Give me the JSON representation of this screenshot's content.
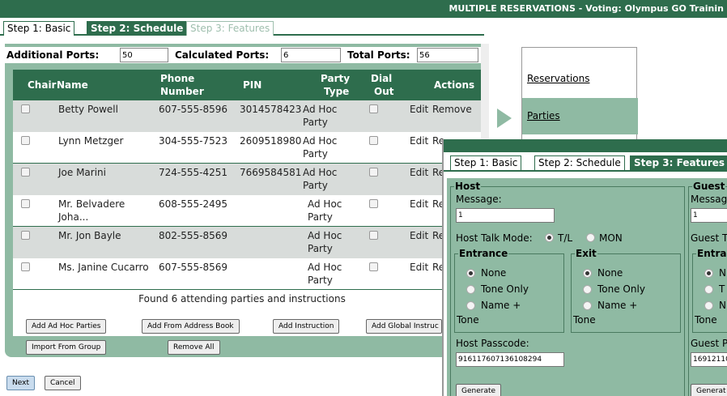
{
  "window_title": "MULTIPLE RESERVATIONS - Voting: Olympus GO Trainin",
  "tabs": [
    "Step 1: Basic",
    "Step 2: Schedule",
    "Step 3: Features"
  ],
  "ports": {
    "additional_label": "Additional Ports:",
    "additional_value": "50",
    "calculated_label": "Calculated Ports:",
    "calculated_value": "6",
    "total_label": "Total Ports:",
    "total_value": "56"
  },
  "columns": {
    "chair": "Chair",
    "name": "Name",
    "phone1": "Phone",
    "phone2": "Number",
    "pin": "PIN",
    "type1": "Party",
    "type2": "Type",
    "dial1": "Dial",
    "dial2": "Out",
    "actions": "Actions"
  },
  "rows": [
    {
      "drag": "::",
      "name1": "Betty Powell",
      "name2": "",
      "phone": "607-555-8596",
      "pin": "3014578423",
      "type1": "Ad Hoc",
      "type2": "Party",
      "edit": "Edit",
      "remove": "Remove"
    },
    {
      "drag": "::",
      "name1": "Lynn Metzger",
      "name2": "",
      "phone": "304-555-7523",
      "pin": "2609518980",
      "type1": "Ad Hoc",
      "type2": "Party",
      "edit": "Edit",
      "remove": "Re"
    },
    {
      "drag": "::",
      "name1": "Joe Marini",
      "name2": "",
      "phone": "724-555-4251",
      "pin": "7669584581",
      "type1": "Ad Hoc",
      "type2": "Party",
      "edit": "Edit",
      "remove": "Re"
    },
    {
      "drag": "::",
      "name1": "Mr. Belvadere",
      "name2": "Joha...",
      "phone": "608-555-2495",
      "pin": "",
      "type1": "Ad Hoc",
      "type2": "Party",
      "edit": "Edit",
      "remove": "Re"
    },
    {
      "drag": "::",
      "name1": "Mr. Jon Bayle",
      "name2": "",
      "phone": "802-555-8569",
      "pin": "",
      "type1": "Ad Hoc",
      "type2": "Party",
      "edit": "Edit",
      "remove": "Re"
    },
    {
      "drag": "::",
      "name1": "Ms. Janine Cucarro",
      "name2": "",
      "phone": "607-555-8569",
      "pin": "",
      "type1": "Ad Hoc",
      "type2": "Party",
      "edit": "Edit",
      "remove": "Re"
    }
  ],
  "found_text": "Found 6 attending parties and instructions",
  "buttons": {
    "add_adhoc": "Add Ad Hoc Parties",
    "add_address": "Add From Address Book",
    "add_instruction": "Add Instruction",
    "add_global": "Add Global Instruc",
    "import_group": "Import From Group",
    "remove_all": "Remove All",
    "next": "Next",
    "cancel": "Cancel"
  },
  "side_nav": [
    "Reservations",
    "Parties"
  ],
  "popup": {
    "tabs": [
      "Step 1: Basic",
      "Step 2: Schedule",
      "Step 3: Features"
    ],
    "host": {
      "legend": "Host",
      "message_label": "Message:",
      "message_value": "1",
      "talk_mode_label": "Host Talk Mode:",
      "talk_mode_opt1": "T/L",
      "talk_mode_opt2": "MON",
      "entrance_legend": "Entrance",
      "exit_legend": "Exit",
      "opt_none": "None",
      "opt_tone_only": "Tone Only",
      "opt_name_plus": "Name +",
      "opt_tone": "Tone",
      "passcode_label": "Host Passcode:",
      "passcode_value": "916117607136108294",
      "generate": "Generate"
    },
    "guest": {
      "legend": "Guest",
      "message_label": "Messag",
      "message_value": "1",
      "talk_mode_label": "Guest T",
      "entrance_legend": "Entra",
      "opt_none": "N",
      "opt_tone_only": "T",
      "opt_name_plus": "N",
      "opt_tone": "Tone",
      "passcode_label": "Guest P",
      "passcode_value": "16912110",
      "generate": "Generat"
    }
  }
}
